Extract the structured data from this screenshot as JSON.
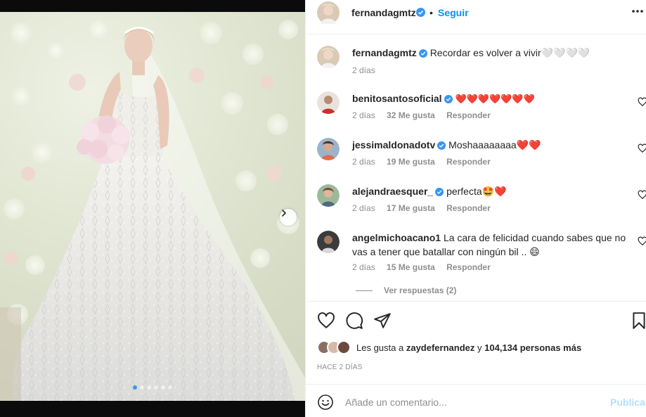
{
  "post": {
    "username": "fernandagmtz",
    "separator": "•",
    "follow_label": "Seguir",
    "more_icon": "more-options-icon"
  },
  "photo": {
    "slides_total": 6,
    "active_slide": 1,
    "next_icon": "chevron-right-icon"
  },
  "comments": [
    {
      "username": "fernandagmtz",
      "verified": true,
      "text": "Recordar es volver a vivir🤍🤍🤍🤍",
      "time": "2 días",
      "likes": "",
      "reply": ""
    },
    {
      "username": "benitosantosoficial",
      "verified": true,
      "text": "❤️❤️❤️❤️❤️❤️❤️",
      "time": "2 días",
      "likes": "32 Me gusta",
      "reply": "Responder"
    },
    {
      "username": "jessimaldonadotv",
      "verified": true,
      "text": "Moshaaaaaaaa❤️❤️",
      "time": "2 días",
      "likes": "19 Me gusta",
      "reply": "Responder"
    },
    {
      "username": "alejandraesquer_",
      "verified": true,
      "text": "perfecta🤩❤️",
      "time": "2 días",
      "likes": "17 Me gusta",
      "reply": "Responder"
    },
    {
      "username": "angelmichoacano1",
      "verified": false,
      "text": "La cara de felicidad cuando sabes que no vas a tener que batallar con ningún bil .. 😄",
      "time": "2 días",
      "likes": "15 Me gusta",
      "reply": "Responder"
    }
  ],
  "view_replies": "Ver respuestas (2)",
  "likes": {
    "prefix": "Les gusta a",
    "user": "zaydefernandez",
    "connector": "y",
    "count_text": "104,134 personas más"
  },
  "timestamp": "HACE 2 DÍAS",
  "add_comment": {
    "placeholder": "Añade un comentario...",
    "post_label": "Publicar"
  },
  "colors": {
    "accent": "#0095f6",
    "verified": "#3897f0",
    "heart": "#e0245e",
    "post_disabled": "#b2dffc"
  }
}
